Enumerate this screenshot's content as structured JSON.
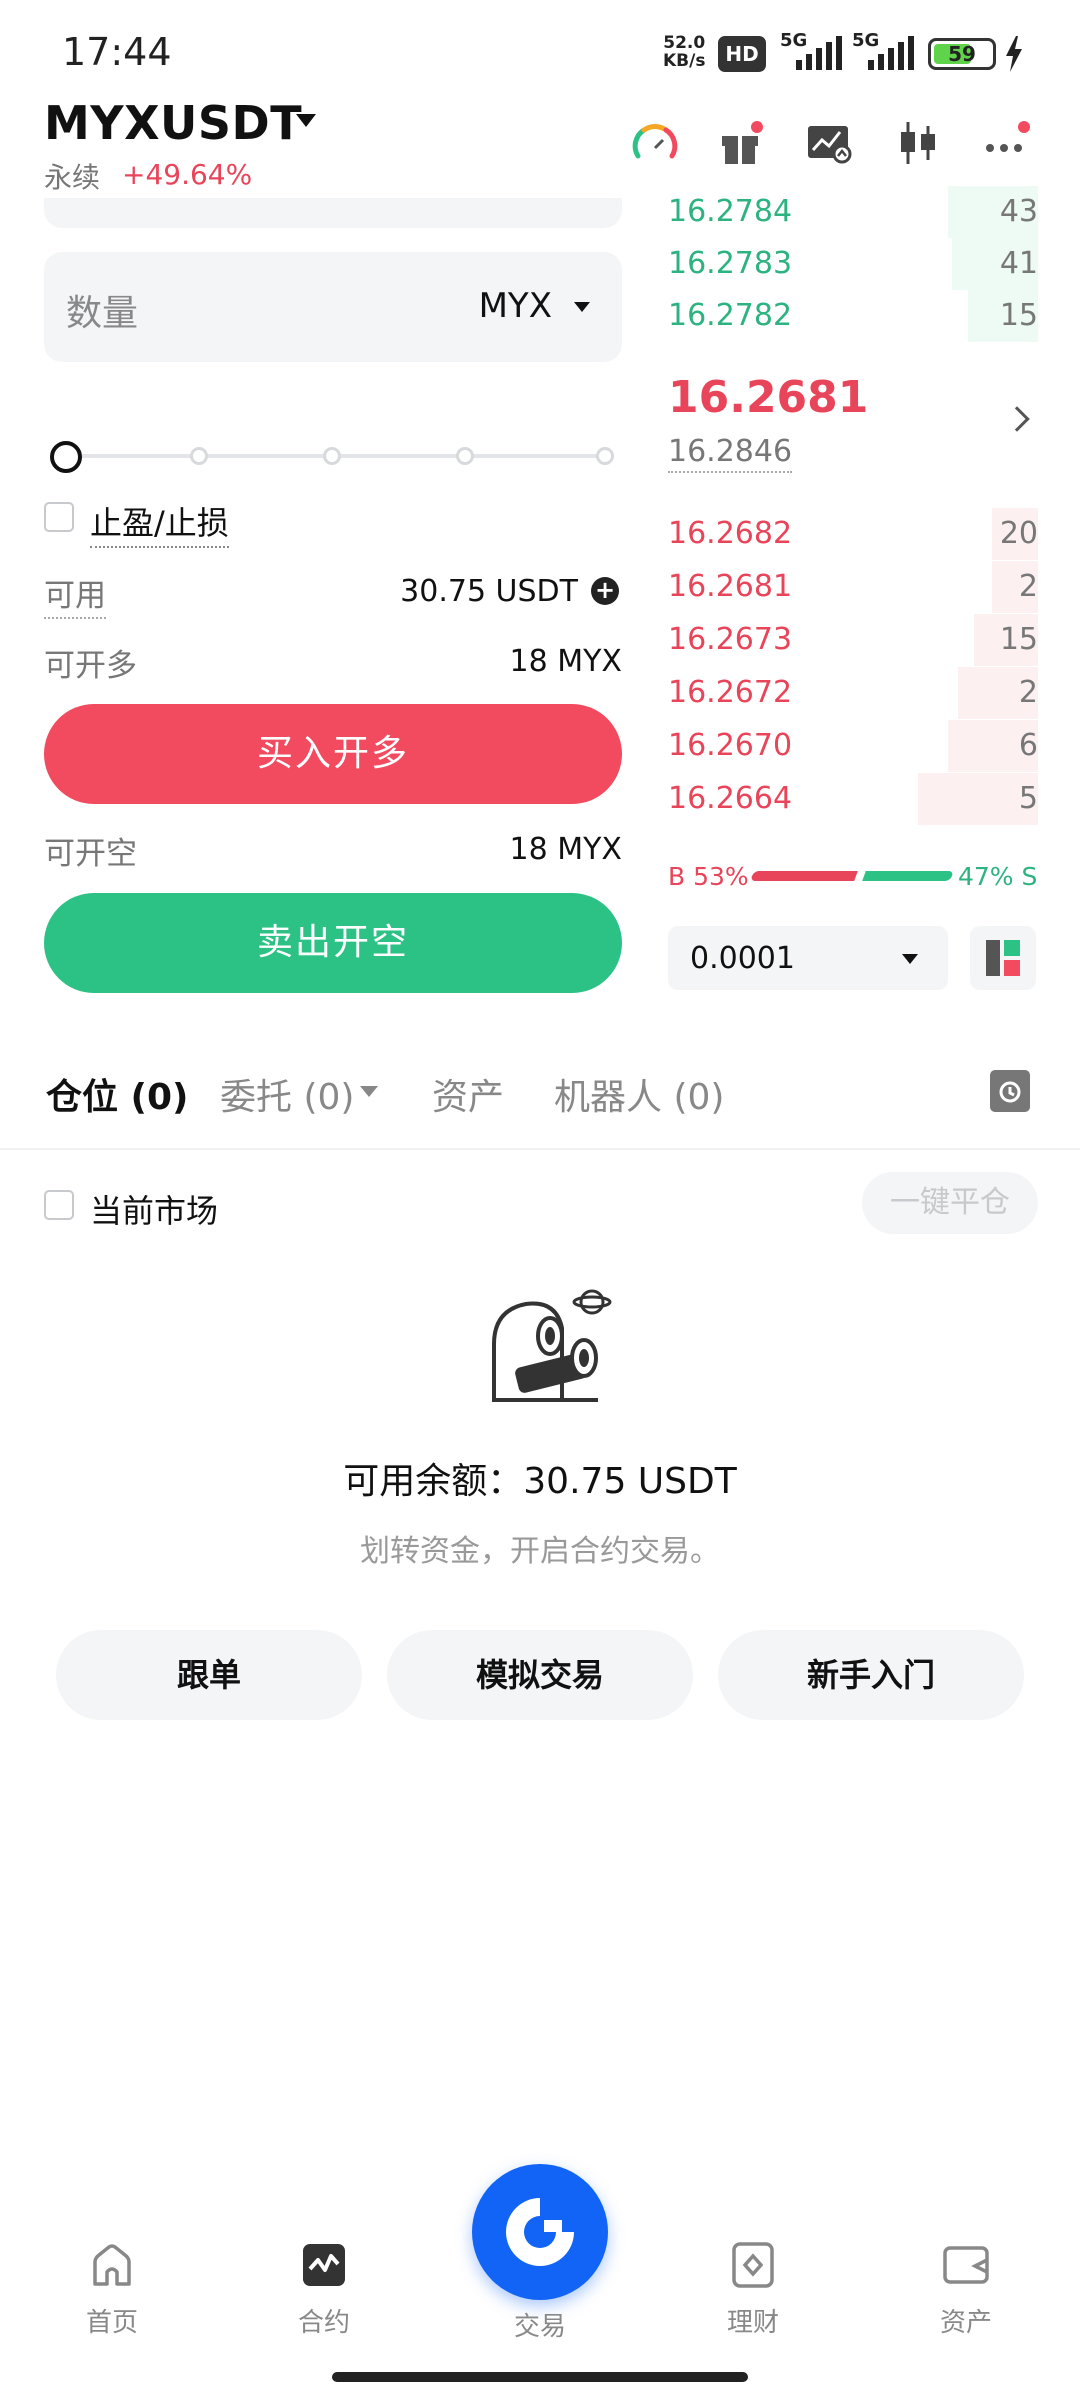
{
  "status_bar": {
    "time": "17:44",
    "net_speed_value": "52.0",
    "net_speed_unit": "KB/s",
    "hd_badge": "HD",
    "signal_1": "5G",
    "signal_2": "5G",
    "battery": "59"
  },
  "header": {
    "pair": "MYXUSDT",
    "contract_type": "永续",
    "change": "+49.64%"
  },
  "order_form": {
    "quantity_label": "数量",
    "quantity_unit": "MYX",
    "slider_percent": 0,
    "tp_sl_label": "止盈/止损",
    "available_label": "可用",
    "available_value": "30.75 USDT",
    "max_long_label": "可开多",
    "max_long_value": "18 MYX",
    "buy_button": "买入开多",
    "max_short_label": "可开空",
    "max_short_value": "18 MYX",
    "sell_button": "卖出开空"
  },
  "order_book": {
    "asks": [
      {
        "price": "16.2784",
        "qty": "43"
      },
      {
        "price": "16.2783",
        "qty": "41"
      },
      {
        "price": "16.2782",
        "qty": "15"
      }
    ],
    "last_price": "16.2681",
    "mark_price": "16.2846",
    "bids": [
      {
        "price": "16.2682",
        "qty": "20"
      },
      {
        "price": "16.2681",
        "qty": "2"
      },
      {
        "price": "16.2673",
        "qty": "15"
      },
      {
        "price": "16.2672",
        "qty": "2"
      },
      {
        "price": "16.2670",
        "qty": "6"
      },
      {
        "price": "16.2664",
        "qty": "5"
      }
    ],
    "buy_ratio": "B 53%",
    "sell_ratio": "47% S",
    "precision": "0.0001"
  },
  "tabs": {
    "positions": "仓位 (0)",
    "orders": "委托 (0)",
    "assets": "资产",
    "bots": "机器人 (0)"
  },
  "positions_panel": {
    "current_market_label": "当前市场",
    "close_all": "一键平仓",
    "available_balance": "可用余额：30.75 USDT",
    "hint": "划转资金，开启合约交易。",
    "btn_copy": "跟单",
    "btn_demo": "模拟交易",
    "btn_beginner": "新手入门"
  },
  "bottom_nav": {
    "home": "首页",
    "futures": "合约",
    "trade": "交易",
    "earn": "理财",
    "assets": "资产"
  },
  "colors": {
    "buy": "#2cc286",
    "sell": "#f24a5f",
    "accent": "#1164f5"
  }
}
